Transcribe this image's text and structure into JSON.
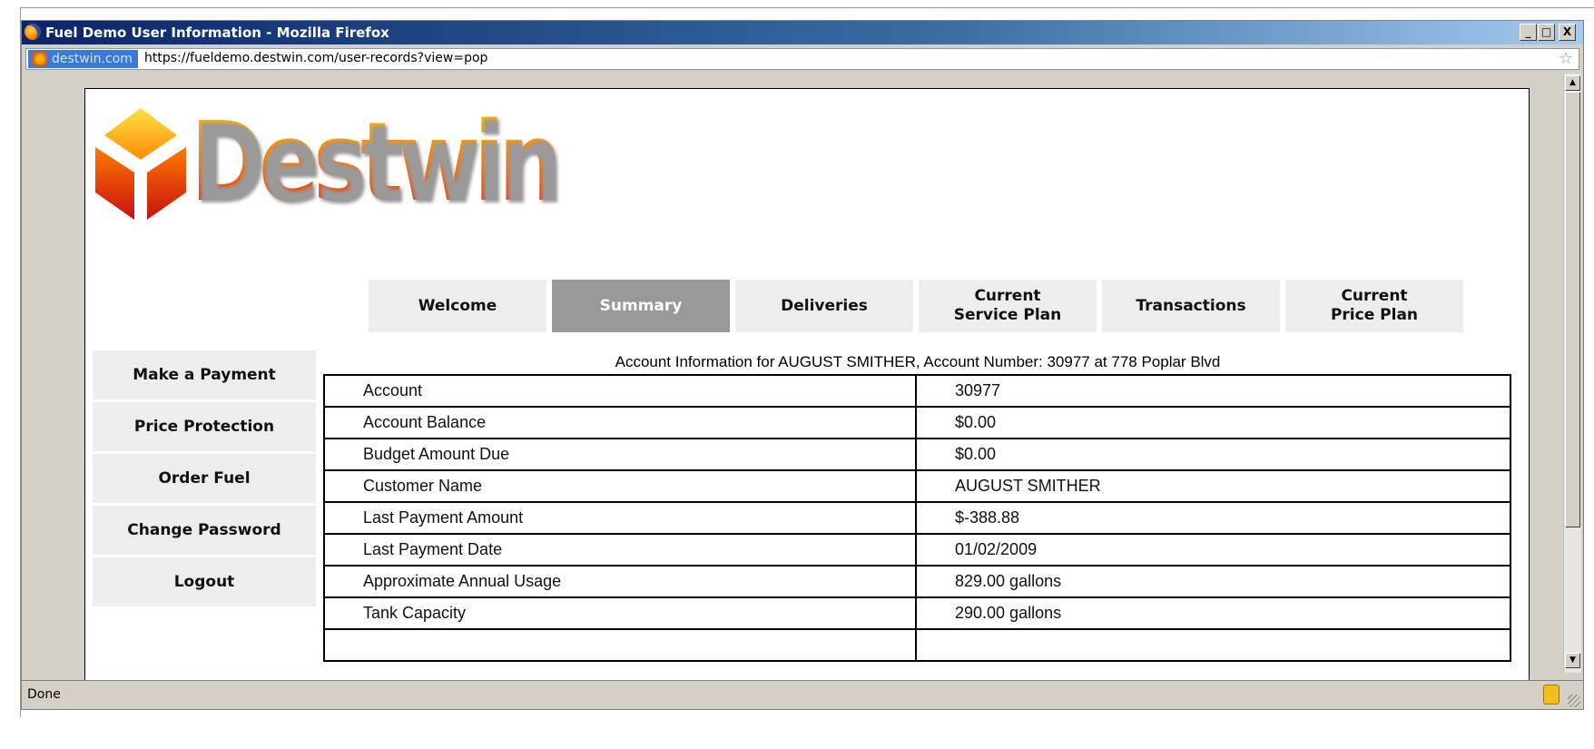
{
  "window": {
    "title": "Fuel Demo User Information - Mozilla Firefox",
    "controls": {
      "minimize": "_",
      "maximize": "□",
      "close": "X"
    }
  },
  "address": {
    "site": "destwin.com",
    "url": "https://fueldemo.destwin.com/user-records?view=pop"
  },
  "logo": {
    "text": "Destwin"
  },
  "tabs": [
    {
      "label": "Welcome"
    },
    {
      "label": "Summary"
    },
    {
      "label": "Deliveries"
    },
    {
      "label": "Current\nService Plan"
    },
    {
      "label": "Transactions"
    },
    {
      "label": "Current\nPrice Plan"
    }
  ],
  "active_tab": "Summary",
  "sidebar": [
    {
      "label": "Make a Payment"
    },
    {
      "label": "Price Protection"
    },
    {
      "label": "Order Fuel"
    },
    {
      "label": "Change Password"
    },
    {
      "label": "Logout"
    }
  ],
  "account": {
    "caption": "Account Information for AUGUST SMITHER, Account Number: 30977 at 778 Poplar Blvd",
    "rows": [
      {
        "label": "Account",
        "value": "30977"
      },
      {
        "label": "Account Balance",
        "value": "$0.00"
      },
      {
        "label": "Budget Amount Due",
        "value": "$0.00"
      },
      {
        "label": "Customer Name",
        "value": "AUGUST SMITHER"
      },
      {
        "label": "Last Payment Amount",
        "value": "$-388.88"
      },
      {
        "label": "Last Payment Date",
        "value": "01/02/2009"
      },
      {
        "label": "Approximate Annual Usage",
        "value": "829.00 gallons"
      },
      {
        "label": "Tank Capacity",
        "value": "290.00 gallons"
      },
      {
        "label": "",
        "value": ""
      }
    ]
  },
  "status": {
    "text": "Done"
  },
  "colors": {
    "active_tab": "#999999",
    "tab_bg": "#ededed",
    "titlebar": "#0a246a"
  }
}
